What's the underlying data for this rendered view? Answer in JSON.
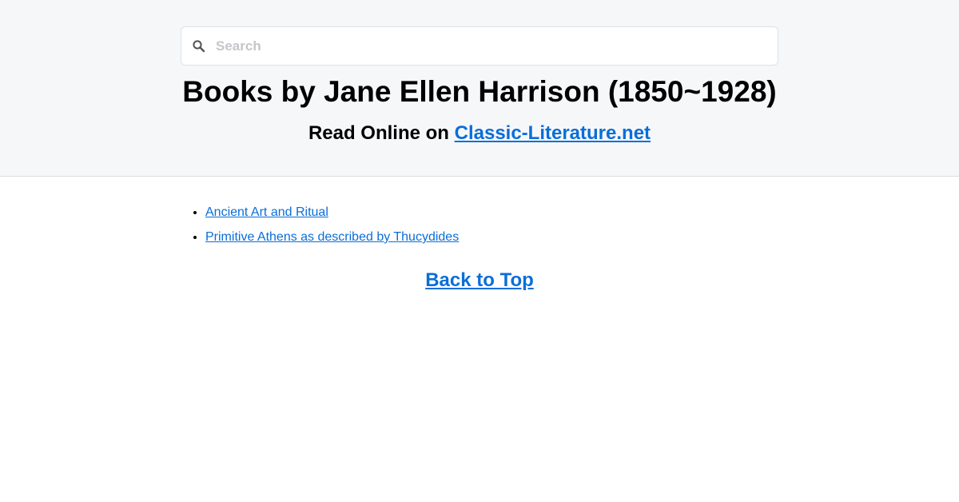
{
  "search": {
    "placeholder": "Search",
    "icon": "search-icon"
  },
  "header": {
    "title": "Books by Jane Ellen Harrison (1850~1928)",
    "subtitle_prefix": "Read Online on ",
    "site_link": "Classic-Literature.net"
  },
  "books": [
    {
      "title": "Ancient Art and Ritual"
    },
    {
      "title": "Primitive Athens as described by Thucydides"
    }
  ],
  "footer": {
    "back_to_top": "Back to Top"
  },
  "colors": {
    "link": "#0a6ed8",
    "header_background": "#f6f7f9",
    "placeholder": "#c4c6ca"
  }
}
